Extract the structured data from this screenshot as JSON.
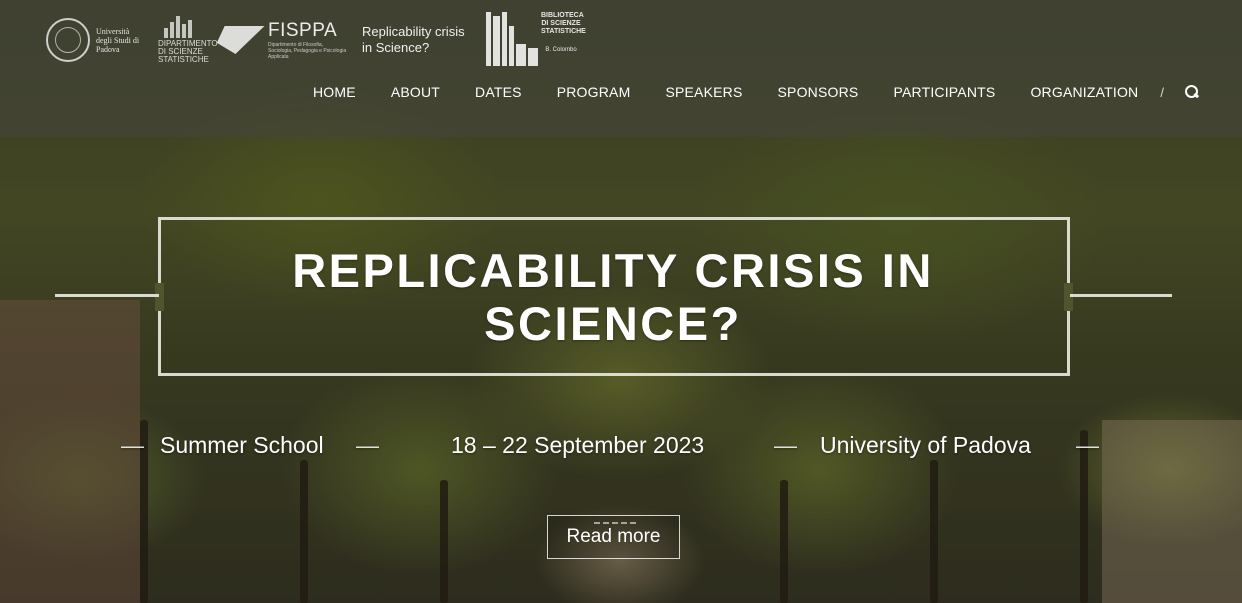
{
  "header": {
    "logos": {
      "unipd_text": "Università degli Studi di Padova",
      "dss_text": "DIPARTIMENTO DI SCIENZE STATISTICHE",
      "fisppa_name": "FISPPA",
      "fisppa_sub": "Dipartimento di Filosofia, Sociologia, Pedagogia e Psicologia Applicata",
      "replicability_text": "Replicability crisis in Science?",
      "biblio_text": "BIBLIOTECA DI SCIENZE STATISTICHE",
      "biblio_signature": "B. Colombo"
    },
    "nav": {
      "items": [
        "HOME",
        "ABOUT",
        "DATES",
        "PROGRAM",
        "SPEAKERS",
        "SPONSORS",
        "PARTICIPANTS",
        "ORGANIZATION"
      ],
      "divider": "/",
      "search_icon": "search-icon"
    }
  },
  "hero": {
    "title": "REPLICABILITY CRISIS IN SCIENCE?",
    "subtitle": {
      "dash": "—",
      "event": "Summer School",
      "dates": "18 – 22 September 2023",
      "venue": "University of Padova"
    },
    "read_more": "Read more"
  },
  "colors": {
    "header_overlay": "#46463e",
    "frame": "#ebebe1",
    "text": "#ffffff"
  }
}
